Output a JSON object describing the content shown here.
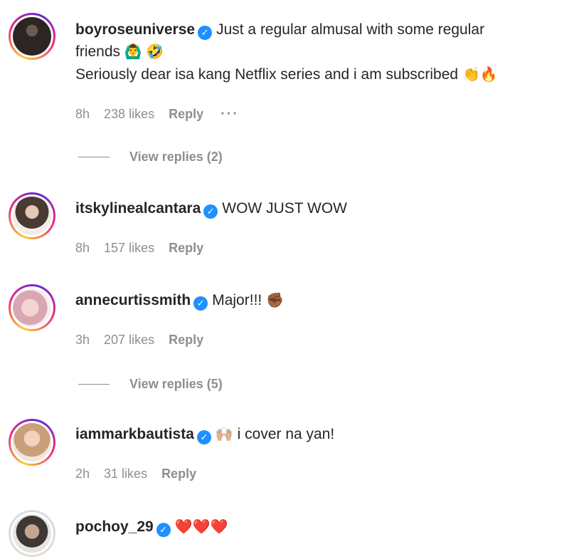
{
  "comments": [
    {
      "username": "boyroseuniverse",
      "text_line1": "Just a regular almusal with some regular",
      "text_line2": "friends",
      "text_line2_emojis": "🙆‍♂️ 🤣",
      "text_line3": "Seriously dear isa kang Netflix series and i am subscribed",
      "text_line3_emojis": "👏🔥",
      "time": "8h",
      "likes": "238 likes",
      "reply": "Reply",
      "more": "···",
      "view_replies": "View replies (2)"
    },
    {
      "username": "itskylinealcantara",
      "text": "WOW JUST WOW",
      "time": "8h",
      "likes": "157 likes",
      "reply": "Reply"
    },
    {
      "username": "annecurtissmith",
      "text": "Major!!!",
      "emoji": "✊🏾",
      "time": "3h",
      "likes": "207 likes",
      "reply": "Reply",
      "view_replies": "View replies (5)"
    },
    {
      "username": "iammarkbautista",
      "emoji": "🙌🏼",
      "text": "i cover na yan!",
      "time": "2h",
      "likes": "31 likes",
      "reply": "Reply"
    },
    {
      "username": "pochoy_29",
      "emoji": "❤️❤️❤️"
    }
  ],
  "icons": {
    "verified": "verified-badge-icon",
    "verified_glyph": "✓"
  },
  "colors": {
    "verified": "#1e90ff",
    "secondary_text": "#8e8e8e",
    "primary_text": "#262626"
  }
}
